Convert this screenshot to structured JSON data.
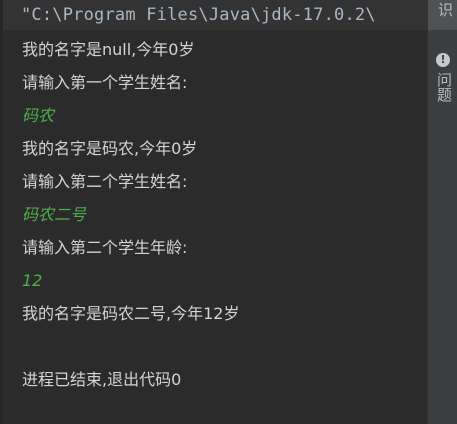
{
  "console": {
    "command": "\"C:\\Program Files\\Java\\jdk-17.0.2\\",
    "lines": [
      {
        "text": "我的名字是null,今年0岁",
        "kind": "output"
      },
      {
        "text": "请输入第一个学生姓名:",
        "kind": "output"
      },
      {
        "text": "码农",
        "kind": "input"
      },
      {
        "text": "我的名字是码农,今年0岁",
        "kind": "output"
      },
      {
        "text": "请输入第二个学生姓名:",
        "kind": "output"
      },
      {
        "text": "码农二号",
        "kind": "input"
      },
      {
        "text": "请输入第二个学生年龄:",
        "kind": "output"
      },
      {
        "text": "12",
        "kind": "input"
      },
      {
        "text": "我的名字是码农二号,今年12岁",
        "kind": "output"
      },
      {
        "text": "",
        "kind": "blank"
      },
      {
        "text": "进程已结束,退出代码0",
        "kind": "output"
      }
    ]
  },
  "side_panel": {
    "top_tab_label": "识",
    "icon": "info-icon",
    "label": "问题"
  },
  "colors": {
    "background": "#2b2b2b",
    "output_text": "#d4d4d4",
    "input_text": "#4eb04c",
    "command_text": "#a9b7c6",
    "panel_background": "#3c3f41"
  }
}
